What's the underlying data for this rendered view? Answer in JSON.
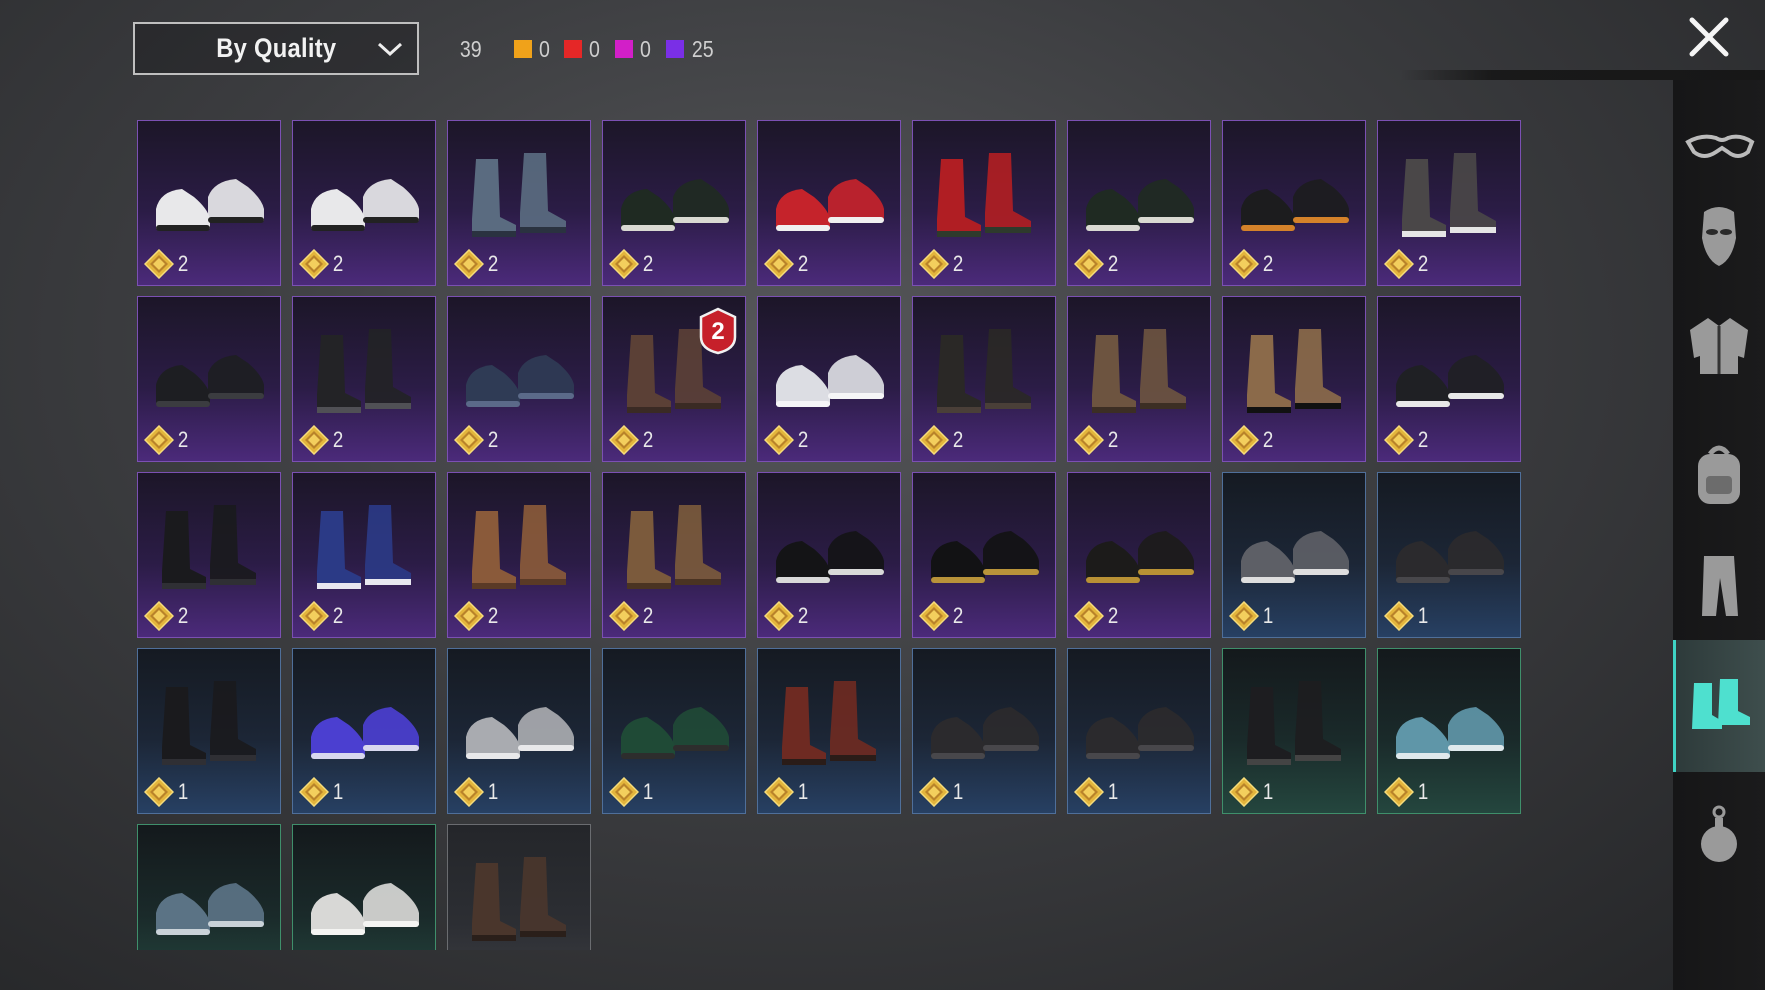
{
  "sort": {
    "label": "By Quality",
    "icon": "chevron-down-icon"
  },
  "counts": {
    "total": "39",
    "qualities": [
      {
        "name": "orange",
        "color": "#f0a21a",
        "count": "0"
      },
      {
        "name": "red",
        "color": "#e52727",
        "count": "0"
      },
      {
        "name": "magenta",
        "color": "#d21fc8",
        "count": "0"
      },
      {
        "name": "purple",
        "color": "#7a2fe6",
        "count": "25"
      }
    ]
  },
  "close": {
    "icon": "close-icon"
  },
  "items": [
    {
      "cost": "2",
      "tier": "purple",
      "shoe": "white-sneakers"
    },
    {
      "cost": "2",
      "tier": "purple",
      "shoe": "white-sneakers"
    },
    {
      "cost": "2",
      "tier": "purple",
      "shoe": "blue-ankle-boots"
    },
    {
      "cost": "2",
      "tier": "purple",
      "shoe": "black-hightops"
    },
    {
      "cost": "2",
      "tier": "purple",
      "shoe": "red-sneakers"
    },
    {
      "cost": "2",
      "tier": "purple",
      "shoe": "red-striped-boots"
    },
    {
      "cost": "2",
      "tier": "purple",
      "shoe": "black-hightops"
    },
    {
      "cost": "2",
      "tier": "purple",
      "shoe": "orange-sole-sneakers"
    },
    {
      "cost": "2",
      "tier": "purple",
      "shoe": "gray-studded-boots"
    },
    {
      "cost": "2",
      "tier": "purple",
      "shoe": "black-loafers"
    },
    {
      "cost": "2",
      "tier": "purple",
      "shoe": "black-buckle-boots"
    },
    {
      "cost": "2",
      "tier": "purple",
      "shoe": "flip-flops"
    },
    {
      "cost": "2",
      "tier": "purple",
      "shoe": "brown-ankle-boots",
      "badge": "2"
    },
    {
      "cost": "2",
      "tier": "purple",
      "shoe": "white-sandals"
    },
    {
      "cost": "2",
      "tier": "purple",
      "shoe": "dark-tall-boots"
    },
    {
      "cost": "2",
      "tier": "purple",
      "shoe": "brown-work-boots"
    },
    {
      "cost": "2",
      "tier": "purple",
      "shoe": "duck-boots"
    },
    {
      "cost": "2",
      "tier": "purple",
      "shoe": "black-white-sneakers"
    },
    {
      "cost": "2",
      "tier": "purple",
      "shoe": "black-tall-boots"
    },
    {
      "cost": "2",
      "tier": "purple",
      "shoe": "blue-white-boots"
    },
    {
      "cost": "2",
      "tier": "purple",
      "shoe": "brown-lace-boots"
    },
    {
      "cost": "2",
      "tier": "purple",
      "shoe": "brown-buckle-boots"
    },
    {
      "cost": "2",
      "tier": "purple",
      "shoe": "black-sneakers"
    },
    {
      "cost": "2",
      "tier": "purple",
      "shoe": "black-gold-sneakers"
    },
    {
      "cost": "2",
      "tier": "purple",
      "shoe": "gold-loafers"
    },
    {
      "cost": "1",
      "tier": "blue",
      "shoe": "gray-sneakers"
    },
    {
      "cost": "1",
      "tier": "blue",
      "shoe": "dark-oxfords"
    },
    {
      "cost": "1",
      "tier": "blue",
      "shoe": "black-tall-boots"
    },
    {
      "cost": "1",
      "tier": "blue",
      "shoe": "violet-sneakers"
    },
    {
      "cost": "1",
      "tier": "blue",
      "shoe": "light-gray-slipons"
    },
    {
      "cost": "1",
      "tier": "blue",
      "shoe": "green-shoes"
    },
    {
      "cost": "1",
      "tier": "blue",
      "shoe": "red-brown-boots"
    },
    {
      "cost": "1",
      "tier": "blue",
      "shoe": "dark-oxfords"
    },
    {
      "cost": "1",
      "tier": "blue",
      "shoe": "dark-oxfords"
    },
    {
      "cost": "1",
      "tier": "green",
      "shoe": "black-strap-boots"
    },
    {
      "cost": "1",
      "tier": "green",
      "shoe": "teal-hightops"
    },
    {
      "cost": "",
      "tier": "green",
      "shoe": "blue-gray-sneakers"
    },
    {
      "cost": "",
      "tier": "green",
      "shoe": "white-running-shoes"
    },
    {
      "cost": "",
      "tier": "gray",
      "shoe": "brown-short-boots"
    }
  ],
  "sidebar": [
    {
      "name": "glasses",
      "icon": "glasses-icon"
    },
    {
      "name": "mask",
      "icon": "mask-icon"
    },
    {
      "name": "jacket",
      "icon": "jacket-icon"
    },
    {
      "name": "backpack",
      "icon": "backpack-icon"
    },
    {
      "name": "pants",
      "icon": "pants-icon"
    },
    {
      "name": "shoes",
      "icon": "shoes-icon",
      "active": true
    },
    {
      "name": "grenade",
      "icon": "grenade-icon"
    }
  ]
}
